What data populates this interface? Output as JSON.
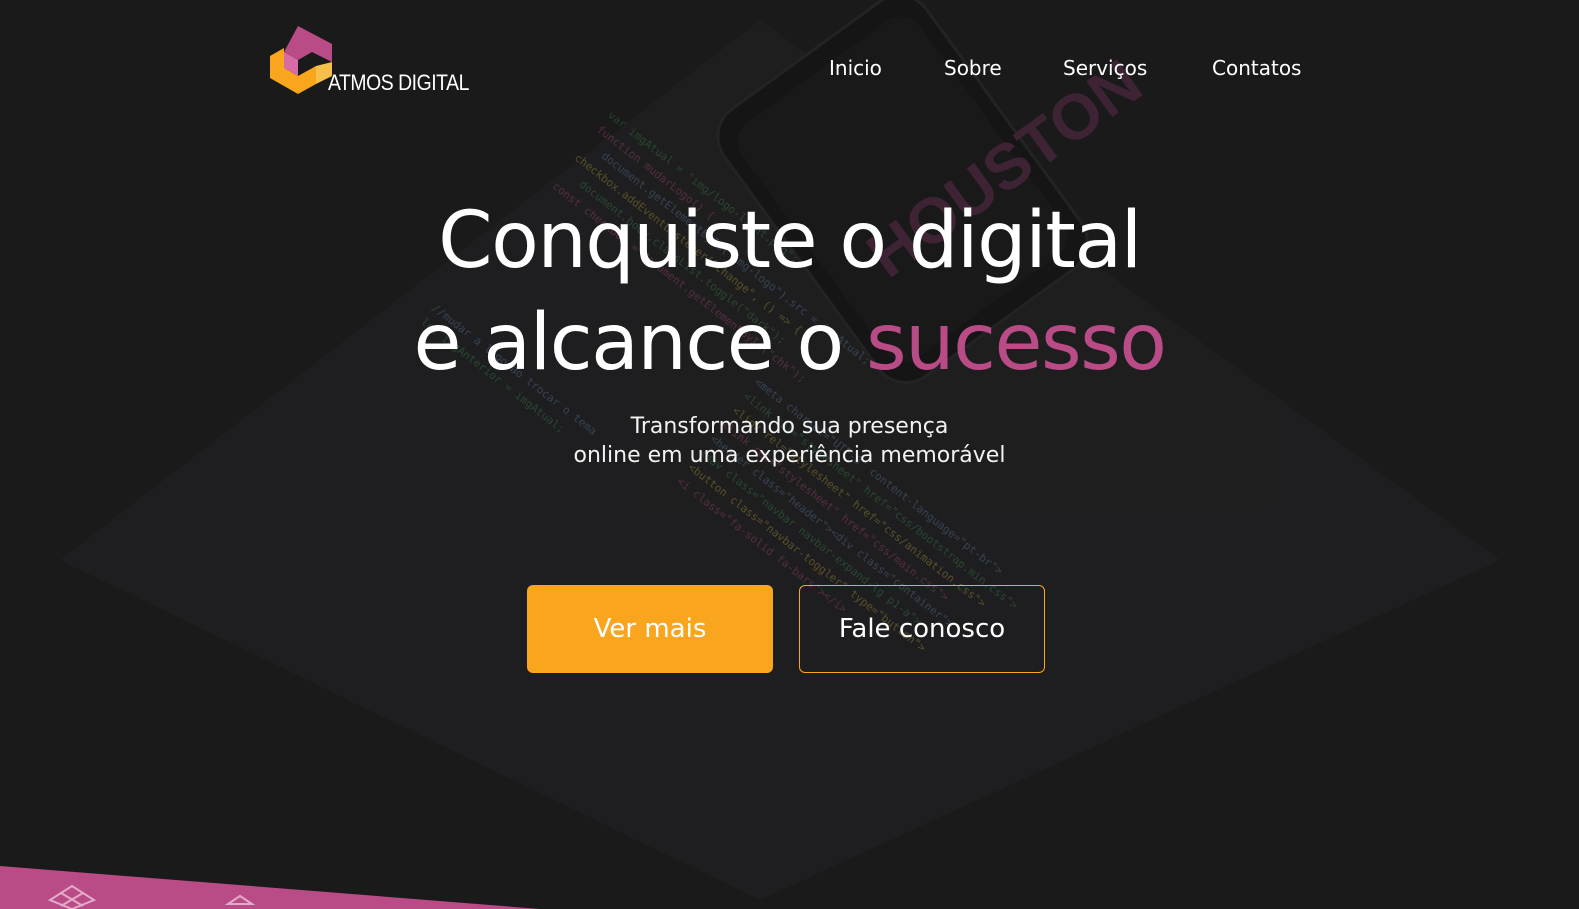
{
  "brand": {
    "name": "ATMOS DIGITAL",
    "logo_icon": "atmos-logo-mark",
    "colors": {
      "primary": "#f9a51e",
      "accent": "#b94b86",
      "background": "#1a1a1b"
    }
  },
  "nav": {
    "items": [
      {
        "label": "Inicio"
      },
      {
        "label": "Sobre"
      },
      {
        "label": "Serviços"
      },
      {
        "label": "Contatos"
      }
    ]
  },
  "hero": {
    "title_line1": "Conquiste o digital",
    "title_line2_prefix": "e alcance o ",
    "title_line2_accent": "sucesso",
    "subtitle_line1": "Transformando sua presença",
    "subtitle_line2": "online em uma experiência memorável",
    "primary_button": "Ver mais",
    "secondary_button": "Fale conosco"
  }
}
